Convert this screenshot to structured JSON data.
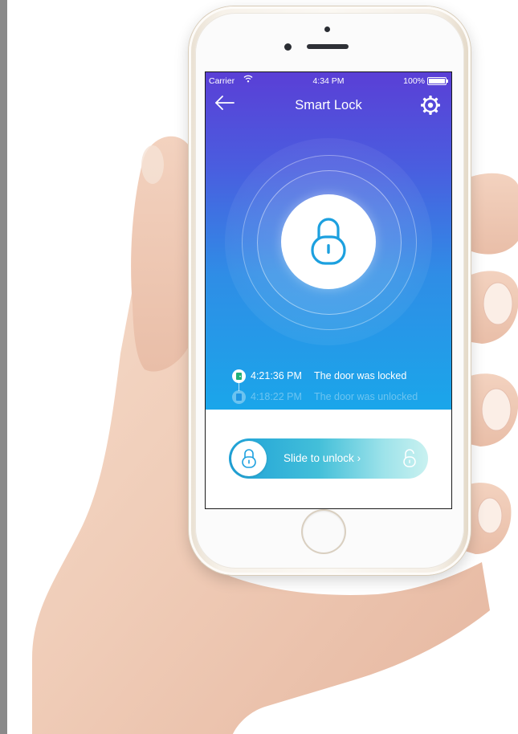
{
  "status_bar": {
    "carrier": "Carrier",
    "time": "4:34 PM",
    "battery": "100%"
  },
  "nav": {
    "title": "Smart Lock"
  },
  "icons": {
    "back": "back-arrow-icon",
    "settings": "gear-icon",
    "lock": "padlock-icon"
  },
  "colors": {
    "gradient_top": "#5a3fd6",
    "gradient_bottom": "#1aa6ea",
    "accent": "#1ca0df",
    "slider_end": "#c9f1f0"
  },
  "log": [
    {
      "time": "4:21:36 PM",
      "message": "The door was locked",
      "state": "locked"
    },
    {
      "time": "4:18:22 PM",
      "message": "The door was unlocked",
      "state": "unlocked"
    }
  ],
  "slider": {
    "label": "Slide to unlock",
    "chevron": "›"
  }
}
